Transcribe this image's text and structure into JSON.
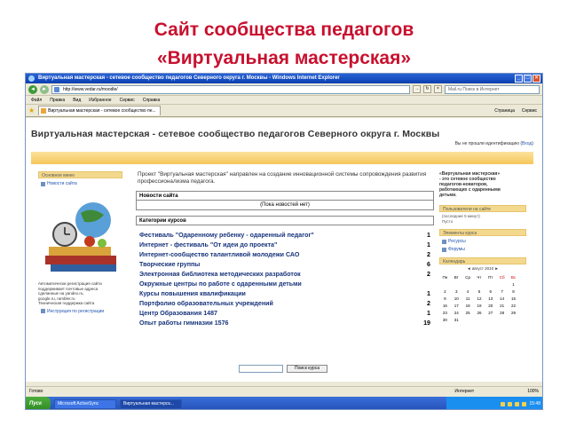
{
  "slide": {
    "title_line1": "Сайт сообщества педагогов",
    "title_line2": "«Виртуальная мастерская»"
  },
  "browser": {
    "window_title": "Виртуальная мастерская - сетевое сообщество педагогов Северного округа г. Москвы - Windows Internet Explorer",
    "url": "http://www.vedar.ru/moodle/",
    "search_placeholder": "Mail.ru Поиск в Интернет",
    "menu": [
      "Файл",
      "Правка",
      "Вид",
      "Избранное",
      "Сервис",
      "Справка"
    ],
    "tab_label": "Виртуальная мастерская - сетевое сообщество пе...",
    "tab_tools": [
      "Страница",
      "Сервис"
    ],
    "status_left": "Готово",
    "status_zone": "Интернет",
    "zoom": "100%"
  },
  "site": {
    "title": "Виртуальная мастерская - сетевое сообщество педагогов Северного округа г. Москвы",
    "login_text": "Вы не прошли идентификацию (",
    "login_link": "Вход",
    "login_close": ")",
    "left": {
      "main_menu_header": "Основное меню",
      "news_link": "Новости сайта",
      "note": "Автоматически регистрация сайта\nподдерживает почтовые адреса\nсделанные на yandex.ru,\ngoogle.ru, rambler.ru\nТехническая поддержка сайта",
      "instruction_link": "Инструкция по регистрации"
    },
    "intro": "Проект \"Виртуальная мастерская\" направлен на создание инновационной системы сопровождения развития профессионализма педагога.",
    "news_header": "Новости сайта",
    "no_news": "(Пока новостей нет)",
    "categories_header": "Категории курсов",
    "courses": [
      {
        "name": "Фестиваль \"Одаренному ребенку - одаренный педагог\"",
        "count": "1"
      },
      {
        "name": "Интернет - фестиваль \"От идеи до проекта\"",
        "count": "1"
      },
      {
        "name": "Интернет-сообщество талантливой молодежи САО",
        "count": "2"
      },
      {
        "name": "Творческие группы",
        "count": "6"
      },
      {
        "name": "Электронная библиотека методических разработок",
        "count": "2"
      },
      {
        "name": "Окружные центры по работе с одаренными детьми",
        "count": ""
      },
      {
        "name": "Курсы повышения квалификации",
        "count": "1"
      },
      {
        "name": "Портфолио образовательных учреждений",
        "count": "2"
      },
      {
        "name": "Центр Образования 1487",
        "count": "1"
      },
      {
        "name": "Опыт работы гимназии 1576",
        "count": "19"
      }
    ],
    "search_button": "Поиск курса",
    "right": {
      "note": "«Виртуальная мастерская»\n- это сетевое сообщество\nпедагогов-новаторов,\nработающих с одаренными\nдетьми.",
      "users_header": "Пользователи на сайте",
      "users_text": "(последние 5 минут)\nПусто",
      "elements_header": "Элементы курса",
      "elements": [
        "Ресурсы",
        "Форумы"
      ],
      "calendar_header": "Календарь",
      "calendar_month": "◄   август 2010   ►",
      "weekdays": [
        "Пн",
        "Вт",
        "Ср",
        "Чт",
        "Пт",
        "Сб",
        "Вс"
      ],
      "weeks": [
        [
          "",
          "",
          "",
          "",
          "",
          "",
          "1"
        ],
        [
          "2",
          "3",
          "4",
          "5",
          "6",
          "7",
          "8"
        ],
        [
          "9",
          "10",
          "11",
          "12",
          "13",
          "14",
          "15"
        ],
        [
          "16",
          "17",
          "18",
          "19",
          "20",
          "21",
          "22"
        ],
        [
          "23",
          "24",
          "25",
          "26",
          "27",
          "28",
          "29"
        ],
        [
          "30",
          "31",
          "",
          "",
          "",
          "",
          ""
        ]
      ]
    }
  },
  "taskbar": {
    "start": "Пуск",
    "tasks": [
      "Microsoft ActiveSync",
      "Виртуальная мастерск..."
    ],
    "clock": "15:48"
  }
}
